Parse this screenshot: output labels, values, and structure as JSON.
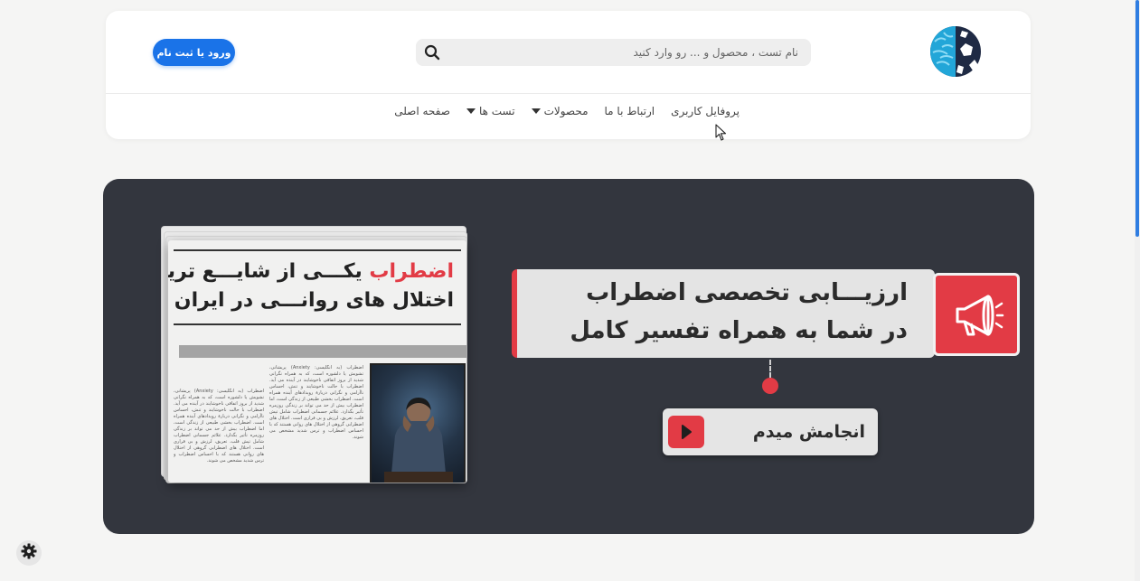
{
  "header": {
    "search": {
      "placeholder": "نام تست ، محصول و ... رو وارد کنید",
      "value": ""
    },
    "login_label": "ورود یا ثبت نام",
    "logo_icon": "brain-soccer-logo-icon"
  },
  "nav": {
    "items": [
      {
        "label": "صفحه اصلی",
        "dropdown": false
      },
      {
        "label": "تست ها",
        "dropdown": true
      },
      {
        "label": "محصولات",
        "dropdown": true
      },
      {
        "label": "ارتباط با ما",
        "dropdown": false
      },
      {
        "label": "پروفایل کاربری",
        "dropdown": false
      }
    ]
  },
  "banner": {
    "newspaper": {
      "headline_accent": "اضطراب",
      "headline_line1_rest": " یکـــی از شایـــع ترین",
      "headline_line2": "اختلال های روانـــی در ایران است",
      "body_text": "اضطراب (به انگلیسی: Anxiety) پریشانی، تشویش یا دلشوره است، که به همراه نگرانی شدید از بروز اتفاقی ناخوشایند در آینده می آید. اضطراب با حالت ناخوشایند و تنش، احساس ناآرامی و نگرانی دربارهٔ رویدادهای آینده همراه است. اضطراب بخشی طبیعی از زندگی است، اما اضطراب بیش از حد می تواند بر زندگی روزمره تأثیر بگذارد. علائم جسمانی اضطراب شامل تپش قلب، تعریق، لرزش و بی قراری است. اختلال های اضطرابی گروهی از اختلال های روانی هستند که با احساس اضطراب و ترس شدید مشخص می شوند."
    },
    "title_line1": "ارزیـــابی تخصصی اضطراب",
    "title_line2": "در شما به همراه تفسیر کامل",
    "cta_label": "انجامش میدم",
    "colors": {
      "accent": "#e23b45",
      "banner_bg": "#33363e",
      "primary_button": "#1a73e8"
    }
  },
  "floating": {
    "settings_icon": "gear-icon"
  }
}
